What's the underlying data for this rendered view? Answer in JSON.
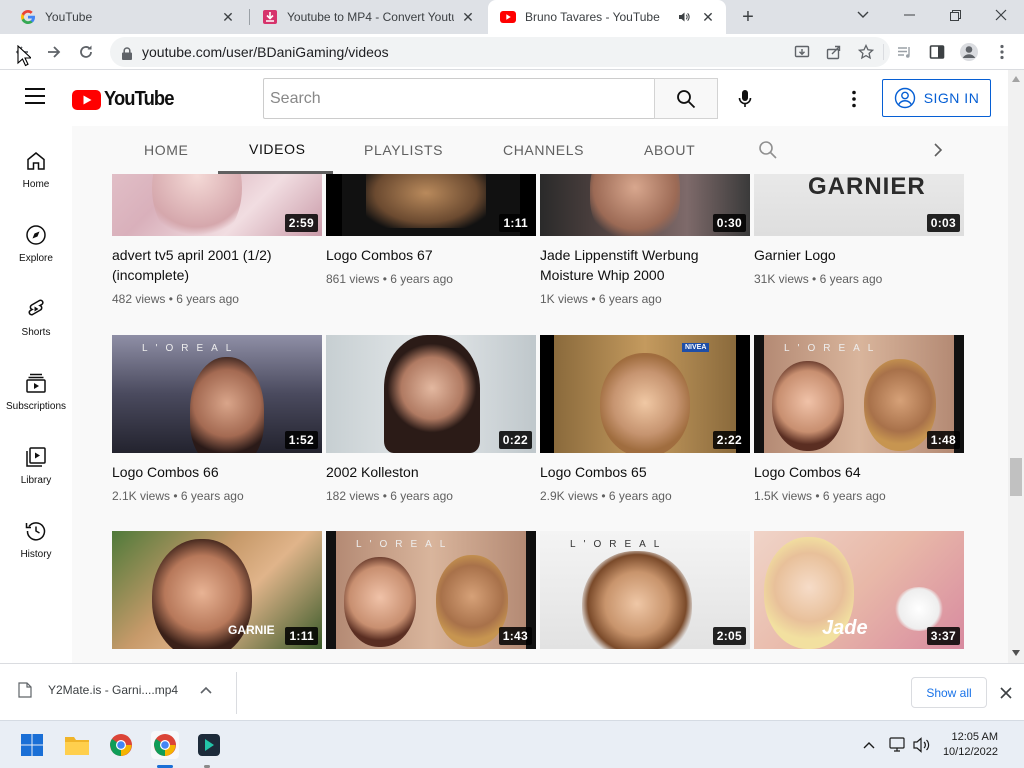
{
  "browser": {
    "tabs": [
      {
        "title": "YouTube"
      },
      {
        "title": "Youtube to MP4 - Convert Youtub"
      },
      {
        "title": "Bruno Tavares - YouTube"
      }
    ],
    "url": "youtube.com/user/BDaniGaming/videos"
  },
  "youtube": {
    "logo_text": "YouTube",
    "search_placeholder": "Search",
    "sign_in": "SIGN IN",
    "guide": [
      {
        "label": "Home",
        "icon": "home-icon"
      },
      {
        "label": "Explore",
        "icon": "compass-icon"
      },
      {
        "label": "Shorts",
        "icon": "shorts-icon"
      },
      {
        "label": "Subscriptions",
        "icon": "subscriptions-icon"
      },
      {
        "label": "Library",
        "icon": "library-icon"
      },
      {
        "label": "History",
        "icon": "history-icon"
      }
    ],
    "channel_tabs": [
      "HOME",
      "VIDEOS",
      "PLAYLISTS",
      "CHANNELS",
      "ABOUT"
    ],
    "selected_tab": "VIDEOS",
    "videos": [
      {
        "title": "advert tv5 april 2001 (1/2) (incomplete)",
        "duration": "2:59",
        "views": "482 views",
        "age": "6 years ago"
      },
      {
        "title": "Logo Combos 67",
        "duration": "1:11",
        "views": "861 views",
        "age": "6 years ago"
      },
      {
        "title": "Jade Lippenstift Werbung Moisture Whip 2000",
        "duration": "0:30",
        "views": "1K views",
        "age": "6 years ago"
      },
      {
        "title": "Garnier Logo",
        "duration": "0:03",
        "views": "31K views",
        "age": "6 years ago"
      },
      {
        "title": "Logo Combos 66",
        "duration": "1:52",
        "views": "2.1K views",
        "age": "6 years ago"
      },
      {
        "title": "2002 Kolleston",
        "duration": "0:22",
        "views": "182 views",
        "age": "6 years ago"
      },
      {
        "title": "Logo Combos 65",
        "duration": "2:22",
        "views": "2.9K views",
        "age": "6 years ago"
      },
      {
        "title": "Logo Combos 64",
        "duration": "1:48",
        "views": "1.5K views",
        "age": "6 years ago"
      },
      {
        "title": "",
        "duration": "1:11",
        "views": "",
        "age": ""
      },
      {
        "title": "",
        "duration": "1:43",
        "views": "",
        "age": ""
      },
      {
        "title": "",
        "duration": "2:05",
        "views": "",
        "age": ""
      },
      {
        "title": "",
        "duration": "3:37",
        "views": "",
        "age": ""
      }
    ],
    "thumb_text": {
      "garnier": "GARNIER",
      "loreal": "L'OREAL",
      "nivea": "NIVEA",
      "garnier_small": "GARNIE",
      "jade": "Jade"
    }
  },
  "download": {
    "file": "Y2Mate.is - Garni....mp4",
    "show_all": "Show all"
  },
  "taskbar": {
    "time": "12:05 AM",
    "date": "10/12/2022"
  }
}
